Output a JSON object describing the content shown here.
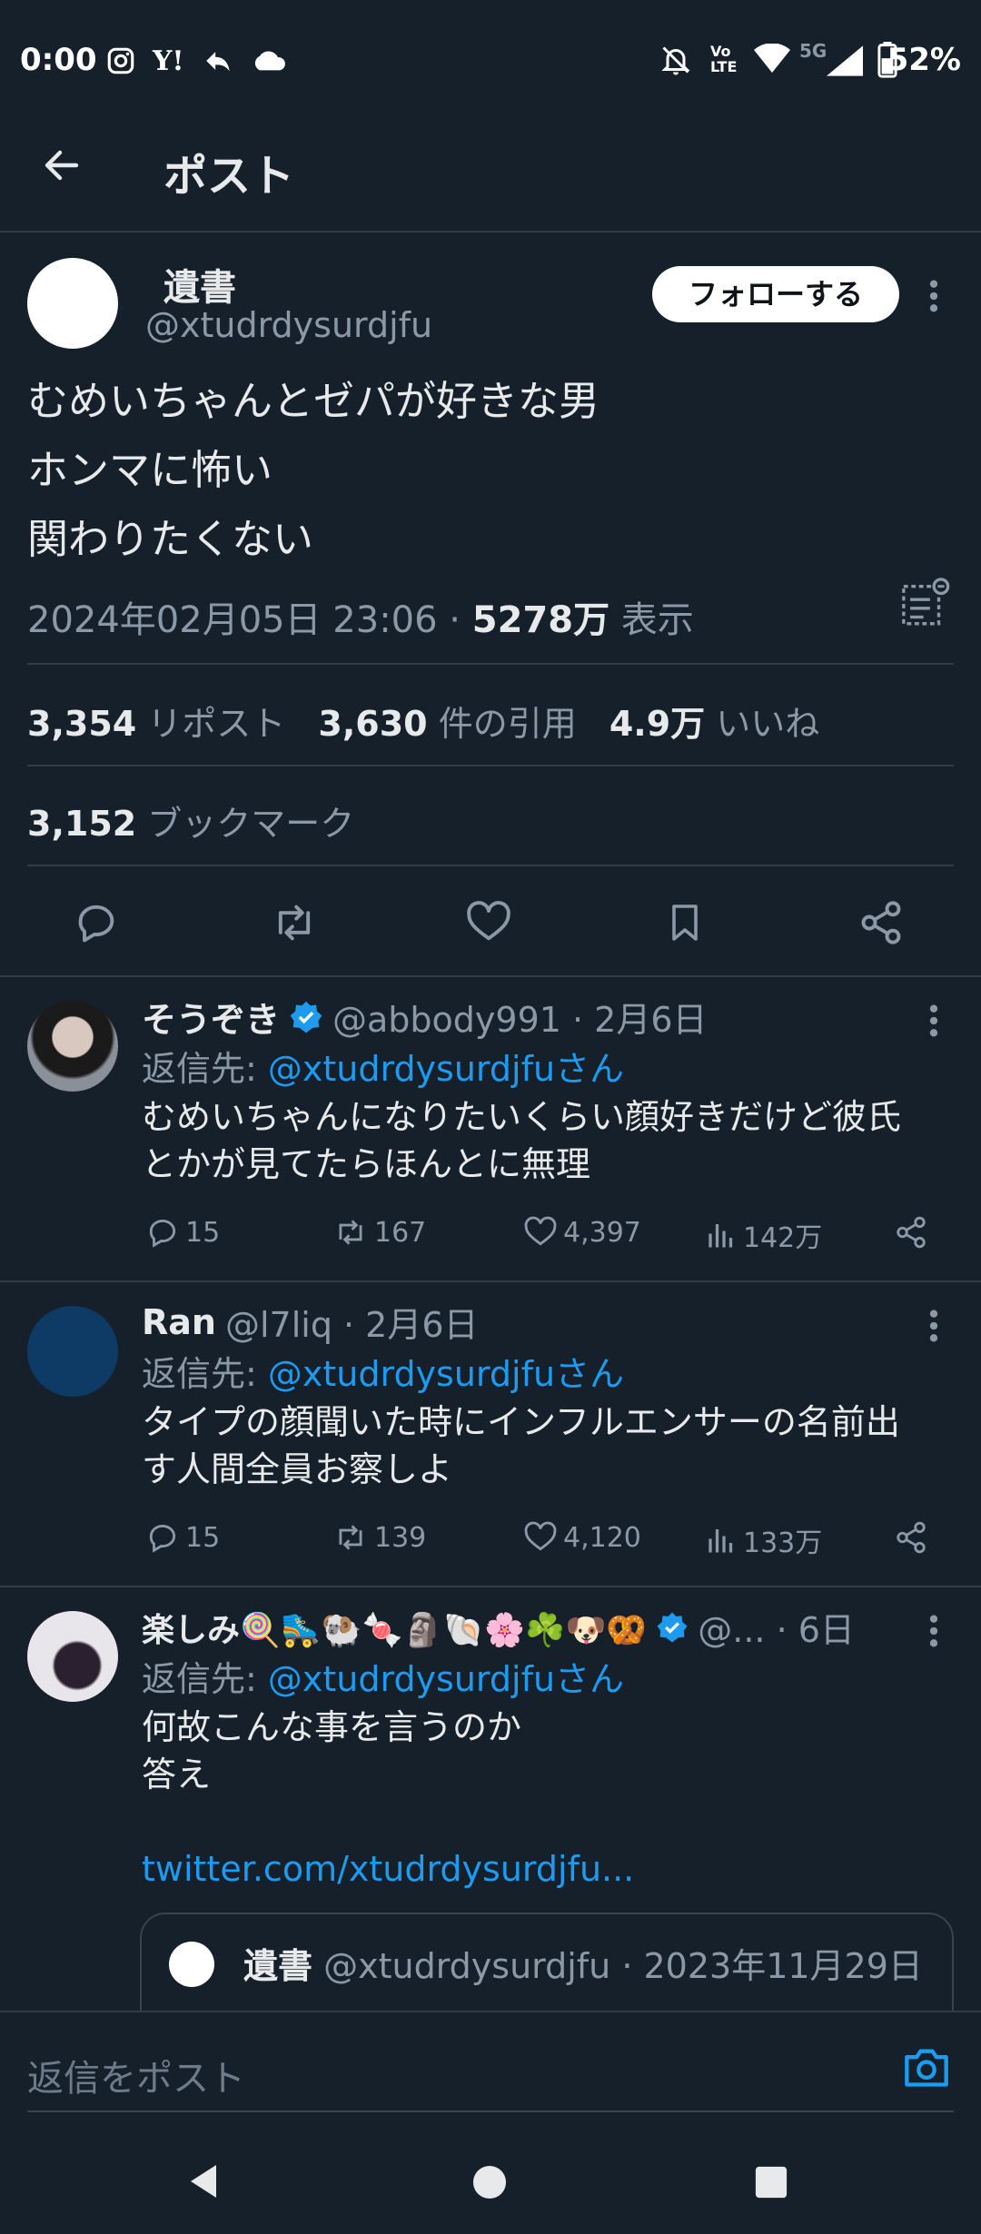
{
  "status_bar": {
    "time": "0:00",
    "battery": "52%",
    "network": "5G",
    "left_icons": [
      "instagram-icon",
      "yahoo-icon",
      "reply-arrow-icon",
      "cloud-icon"
    ],
    "right_icons": [
      "bell-off-icon",
      "volte-icon",
      "wifi-icon",
      "signal-icon",
      "battery-icon"
    ]
  },
  "header": {
    "title": "ポスト"
  },
  "post": {
    "display_name": "遺書",
    "handle": "@xtudrdysurdjfu",
    "follow_label": "フォローする",
    "lines": [
      "むめいちゃんとゼパが好きな男",
      "ホンマに怖い",
      "関わりたくない"
    ],
    "datetime": "2024年02月05日 23:06",
    "views_count": "5278万",
    "views_label": "表示",
    "reposts_count": "3,354",
    "reposts_label": "リポスト",
    "quotes_count": "3,630",
    "quotes_label": "件の引用",
    "likes_count": "4.9万",
    "likes_label": "いいね",
    "bookmarks_count": "3,152",
    "bookmarks_label": "ブックマーク"
  },
  "replies": [
    {
      "name": "そうぞき",
      "verified": true,
      "handle_date": "@abbody991 · 2月6日",
      "reply_to_prefix": "返信先: ",
      "reply_to": "@xtudrdysurdjfuさん",
      "text_lines": [
        "むめいちゃんになりたいくらい顔好きだけど彼氏",
        "とかが見てたらほんとに無理"
      ],
      "comments": "15",
      "reposts": "167",
      "likes": "4,397",
      "views": "142万"
    },
    {
      "name": "Ran",
      "verified": false,
      "handle_date": "@l7liq · 2月6日",
      "reply_to_prefix": "返信先: ",
      "reply_to": "@xtudrdysurdjfuさん",
      "text_lines": [
        "タイプの顔聞いた時にインフルエンサーの名前出",
        "す人間全員お察しよ"
      ],
      "comments": "15",
      "reposts": "139",
      "likes": "4,120",
      "views": "133万"
    },
    {
      "name": "楽しみ🍭🛼🐏🍬🗿🐚🌸☘️🐶🥨",
      "verified": true,
      "handle_date": "@... · 6日",
      "reply_to_prefix": "返信先: ",
      "reply_to": "@xtudrdysurdjfuさん",
      "text_lines": [
        "何故こんな事を言うのか",
        "答え"
      ],
      "link": "twitter.com/xtudrdysurdjfu...",
      "quoted": {
        "name": "遺書",
        "handle_date": "@xtudrdysurdjfu · 2023年11月29日"
      }
    }
  ],
  "compose": {
    "placeholder": "返信をポスト"
  },
  "colors": {
    "background": "#15202b",
    "accent": "#1d9bf0",
    "text": "#e7e9ea",
    "muted": "#8b98a5"
  }
}
